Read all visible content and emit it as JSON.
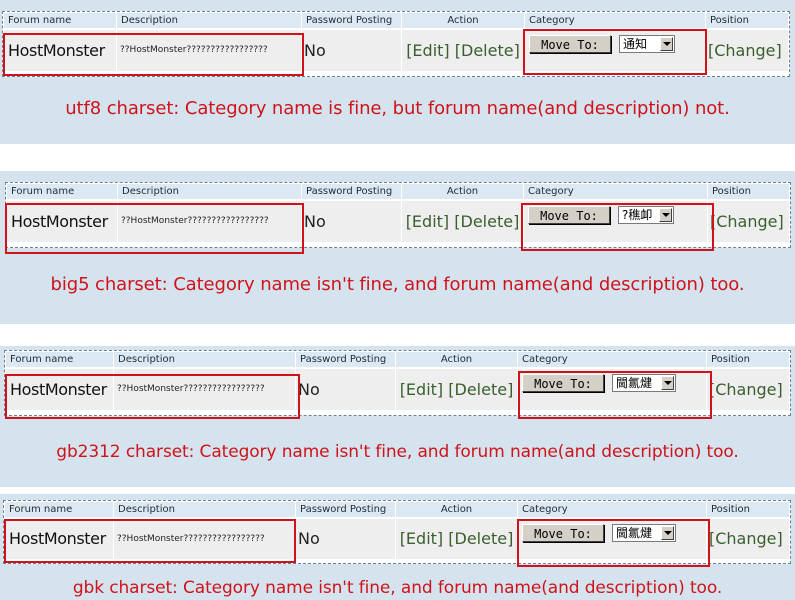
{
  "headers": {
    "forum_name": "Forum name",
    "description": "Description",
    "password_posting": "Password Posting",
    "action": "Action",
    "category": "Category",
    "position": "Position"
  },
  "row": {
    "forum_name": "HostMonster",
    "description": "??HostMonster?????????????????",
    "password_posting": "No",
    "edit_label": "[Edit]",
    "delete_label": "[Delete]",
    "move_to_label": "Move To:",
    "change_label": "[Change]"
  },
  "variants": [
    {
      "charset": "utf8",
      "category_selected": "通知",
      "caption": "utf8 charset: Category name is fine, but forum name(and description) not."
    },
    {
      "charset": "big5",
      "category_selected": "?穛卹",
      "caption": "big5 charset: Category name isn't fine, and forum name(and description) too."
    },
    {
      "charset": "gb2312",
      "category_selected": "閫氱煡",
      "caption": "gb2312 charset: Category name isn't fine, and forum name(and description) too."
    },
    {
      "charset": "gbk",
      "category_selected": "閫氱煡",
      "caption": "gbk charset: Category name isn't fine, and forum name(and description) too."
    }
  ],
  "colors": {
    "panel_bg": "#d5e3ef",
    "header_bg": "#dce9f3",
    "cell_bg": "#eeeeee",
    "highlight": "#d0131a",
    "caption": "#d0131a",
    "link": "#3a5e2e"
  }
}
